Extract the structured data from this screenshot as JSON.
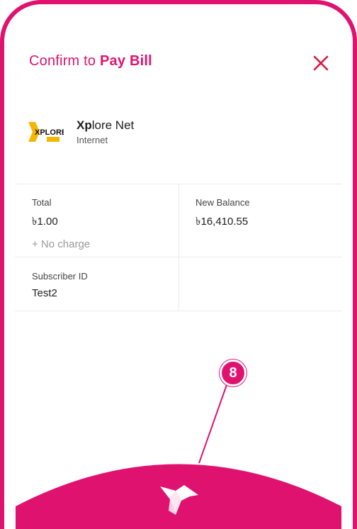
{
  "header": {
    "title_prefix": "Confirm to ",
    "title_action": "Pay Bill",
    "close_icon": "close-icon"
  },
  "biller": {
    "name_bold": "Xp",
    "name_rest": "lore Net",
    "category": "Internet",
    "logo_text": "XPLORE"
  },
  "details": {
    "total_label": "Total",
    "total_value": "৳1.00",
    "charge_note": "+ No charge",
    "new_balance_label": "New Balance",
    "new_balance_value": "৳16,410.55",
    "subscriber_label": "Subscriber ID",
    "subscriber_value": "Test2"
  },
  "annotation": {
    "marker_number": "8"
  },
  "pay_button": {
    "icon": "bird-icon"
  },
  "colors": {
    "accent": "#e0126f",
    "logo_yellow": "#f5b800"
  }
}
